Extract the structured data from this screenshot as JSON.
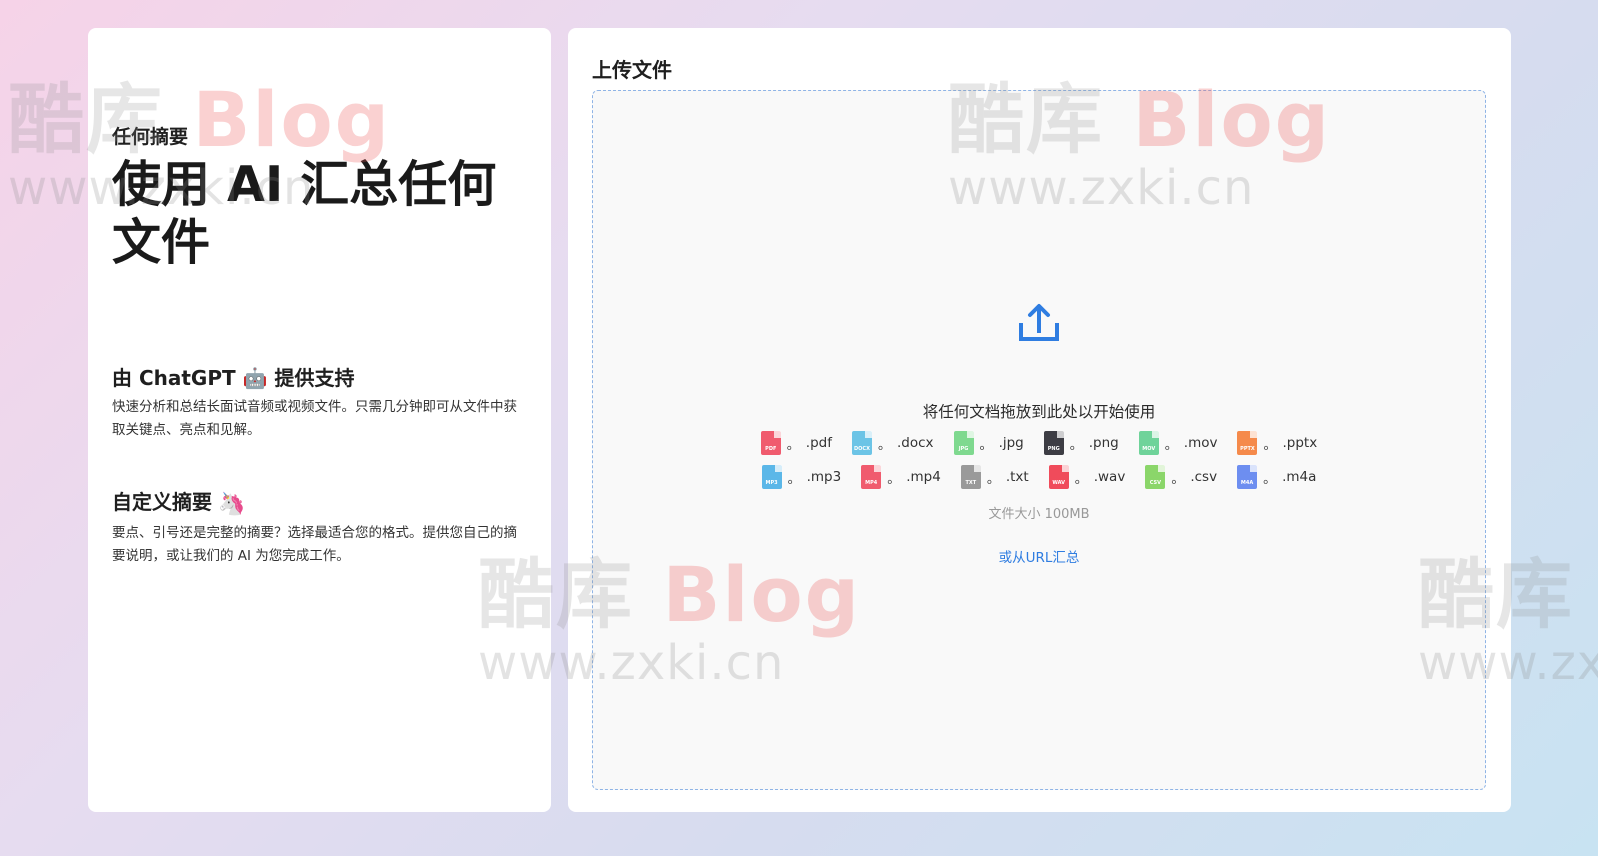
{
  "left": {
    "eyebrow": "任何摘要",
    "title": "使用 AI 汇总任何文件",
    "features": [
      {
        "title": "由 ChatGPT 🤖 提供支持",
        "description": "快速分析和总结长面试音频或视频文件。只需几分钟即可从文件中获取关键点、亮点和见解。"
      },
      {
        "title": "自定义摘要",
        "emoji": "🦄",
        "description": "要点、引号还是完整的摘要？选择最适合您的格式。提供您自己的摘要说明，或让我们的 AI 为您完成工作。"
      }
    ]
  },
  "upload": {
    "title": "上传文件",
    "drop_text": "将任何文档拖放到此处以开始使用",
    "icon": "upload-icon",
    "file_types_row1": [
      {
        "ext": ".pdf",
        "tag": "PDF",
        "color": "#f05b6e"
      },
      {
        "ext": ".docx",
        "tag": "DOCX",
        "color": "#6cc4e6"
      },
      {
        "ext": ".jpg",
        "tag": "JPG",
        "color": "#7fd98f"
      },
      {
        "ext": ".png",
        "tag": "PNG",
        "color": "#3d3d44"
      },
      {
        "ext": ".mov",
        "tag": "MOV",
        "color": "#6fd39a"
      },
      {
        "ext": ".pptx",
        "tag": "PPTX",
        "color": "#f58a4b"
      }
    ],
    "file_types_row2": [
      {
        "ext": ".mp3",
        "tag": "MP3",
        "color": "#5bb7e8"
      },
      {
        "ext": ".mp4",
        "tag": "MP4",
        "color": "#f05b6e"
      },
      {
        "ext": ".txt",
        "tag": "TXT",
        "color": "#9a9a9a"
      },
      {
        "ext": ".wav",
        "tag": "WAV",
        "color": "#f04b5b"
      },
      {
        "ext": ".csv",
        "tag": "CSV",
        "color": "#8bd66a"
      },
      {
        "ext": ".m4a",
        "tag": "M4A",
        "color": "#6d8ef0"
      }
    ],
    "separator": "。",
    "size_limit": "文件大小 100MB",
    "url_link": "或从URL汇总"
  },
  "watermark": {
    "brand_cn": "酷库",
    "brand_en": "Blog",
    "url": "www.zxki.cn"
  },
  "colors": {
    "accent": "#2f7de1",
    "dropzone_border": "#8fb4e6"
  }
}
